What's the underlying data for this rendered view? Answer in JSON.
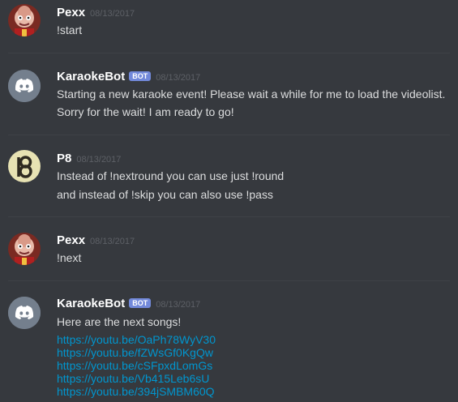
{
  "messages": [
    {
      "author": "Pexx",
      "timestamp": "08/13/2017",
      "bot_tag": "",
      "avatar": "pexx-avatar",
      "lines": [
        "!start"
      ]
    },
    {
      "author": "KaraokeBot",
      "timestamp": "08/13/2017",
      "bot_tag": "BOT",
      "avatar": "discord-logo-avatar",
      "lines": [
        "Starting a new karaoke event! Please wait a while for me to load the videolist.",
        "Sorry for the wait! I am ready to go!"
      ]
    },
    {
      "author": "P8",
      "timestamp": "08/13/2017",
      "bot_tag": "",
      "avatar": "p8-avatar",
      "lines": [
        "Instead of !nextround you can use just !round",
        "and instead of !skip you can also use !pass"
      ]
    },
    {
      "author": "Pexx",
      "timestamp": "08/13/2017",
      "bot_tag": "",
      "avatar": "pexx-avatar",
      "lines": [
        "!next"
      ]
    },
    {
      "author": "KaraokeBot",
      "timestamp": "08/13/2017",
      "bot_tag": "BOT",
      "avatar": "discord-logo-avatar",
      "lines": [
        "Here are the next songs!"
      ],
      "links": [
        "https://youtu.be/OaPh78WyV30",
        "https://youtu.be/fZWsGf0KgQw",
        "https://youtu.be/cSFpxdLomGs",
        "https://youtu.be/Vb415Leb6sU",
        "https://youtu.be/394jSMBM60Q"
      ]
    }
  ],
  "colors": {
    "background": "#36393e",
    "username": "#ffffff",
    "timestamp": "#5d6066",
    "text": "#dcddde",
    "link": "#0096cf",
    "bot_tag": "#7289da"
  }
}
